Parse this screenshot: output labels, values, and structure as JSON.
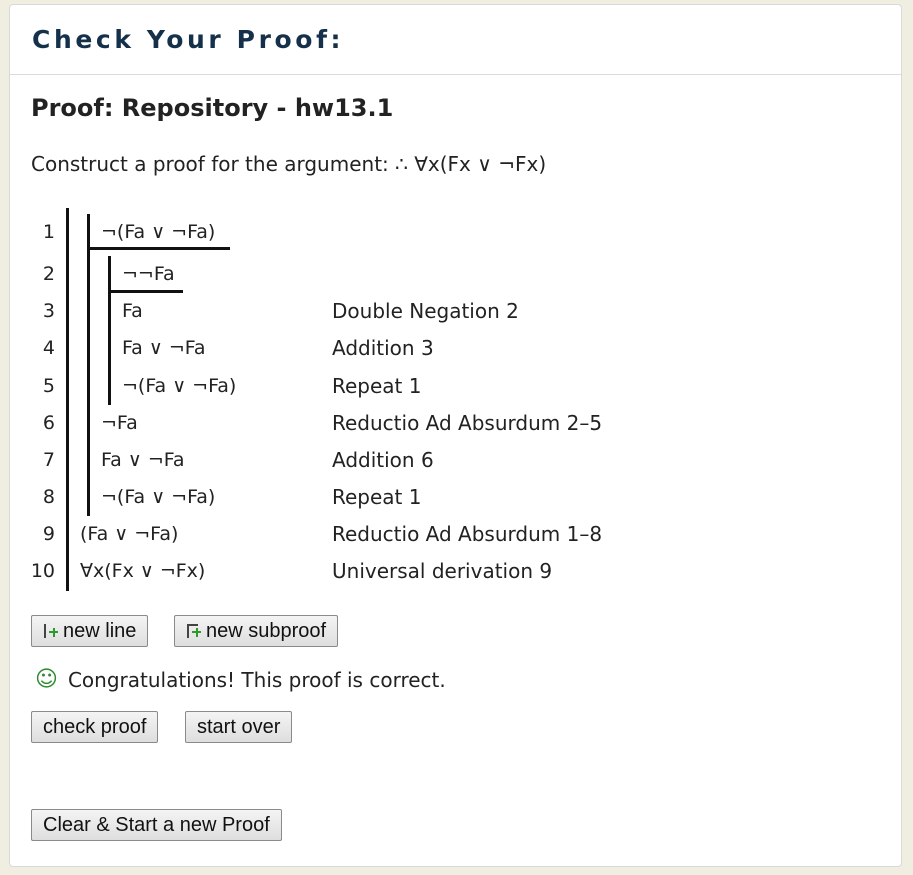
{
  "header": {
    "title": "Check Your Proof:"
  },
  "proof": {
    "title": "Proof: Repository - hw13.1",
    "instructions_prefix": "Construct a proof for the argument: ",
    "argument": "∴ ∀x(Fx ∨ ¬Fx)",
    "lines": [
      {
        "num": "1",
        "formula": "¬(Fa ∨ ¬Fa)",
        "justification": ""
      },
      {
        "num": "2",
        "formula": "¬¬Fa",
        "justification": ""
      },
      {
        "num": "3",
        "formula": "Fa",
        "justification": "Double Negation 2"
      },
      {
        "num": "4",
        "formula": "Fa ∨ ¬Fa",
        "justification": "Addition 3"
      },
      {
        "num": "5",
        "formula": "¬(Fa ∨ ¬Fa)",
        "justification": "Repeat 1"
      },
      {
        "num": "6",
        "formula": "¬Fa",
        "justification": "Reductio Ad Absurdum 2–5"
      },
      {
        "num": "7",
        "formula": "Fa ∨ ¬Fa",
        "justification": "Addition 6"
      },
      {
        "num": "8",
        "formula": "¬(Fa ∨ ¬Fa)",
        "justification": "Repeat 1"
      },
      {
        "num": "9",
        "formula": "(Fa ∨ ¬Fa)",
        "justification": "Reductio Ad Absurdum 1–8"
      },
      {
        "num": "10",
        "formula": "∀x(Fx ∨ ¬Fx)",
        "justification": "Universal derivation 9"
      }
    ]
  },
  "toolbar": {
    "new_line_label": "new line",
    "new_subproof_label": "new subproof",
    "new_line_icon": "add-line-icon",
    "new_subproof_icon": "add-subproof-icon"
  },
  "status": {
    "icon": "smiley-icon",
    "message": "Congratulations! This proof is correct."
  },
  "actions": {
    "check_label": "check proof",
    "start_over_label": "start over",
    "clear_label": "Clear & Start a new Proof"
  },
  "colors": {
    "page_background": "#f0eee0",
    "title": "#14304a",
    "success": "#2d8a2d",
    "add_icon": "#2e9a2e"
  }
}
